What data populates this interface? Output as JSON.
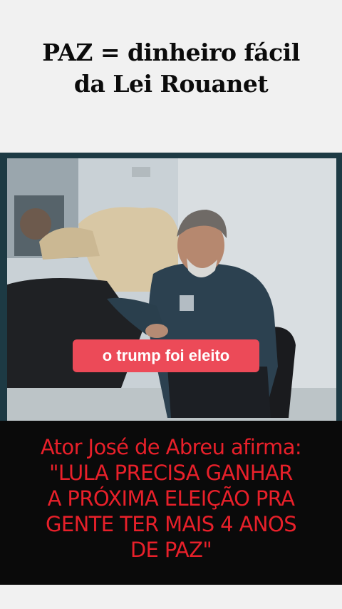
{
  "headline": {
    "line1": "PAZ = dinheiro fácil",
    "line2": "da Lei Rouanet"
  },
  "video": {
    "caption": "o trump foi eleito"
  },
  "quote": {
    "lines": [
      "Ator José de Abreu afirma:",
      "\"LULA PRECISA GANHAR",
      "A PRÓXIMA ELEIÇÃO PRA",
      "GENTE TER MAIS 4 ANOS",
      "DE PAZ\""
    ],
    "color": "#e8202a"
  },
  "colors": {
    "page_background": "#f1f1f1",
    "caption_background": "#ec4a58",
    "quote_background": "#0a0a0a"
  }
}
